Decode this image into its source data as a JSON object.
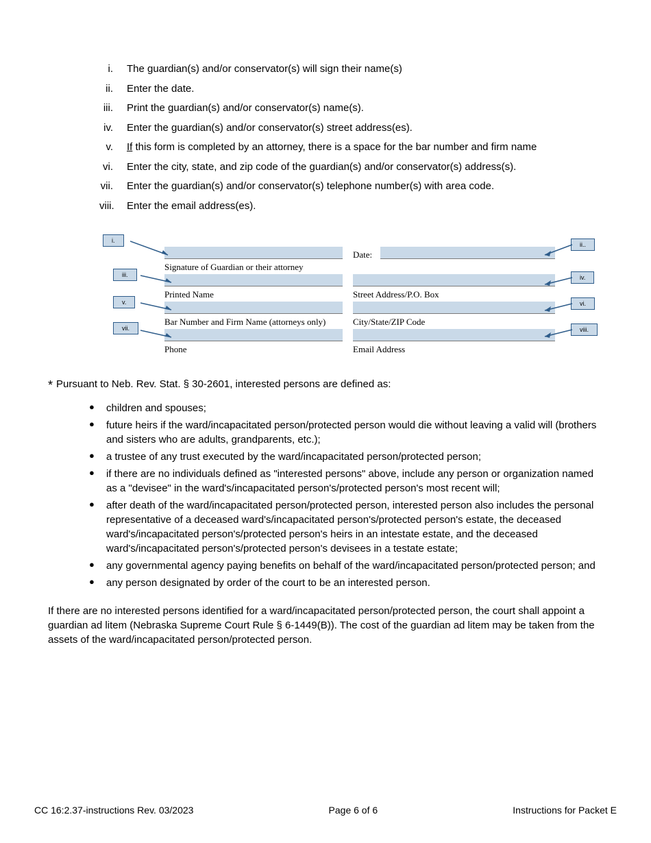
{
  "roman_list": [
    {
      "num": "i.",
      "text": "The guardian(s) and/or conservator(s) will sign their name(s)"
    },
    {
      "num": "ii.",
      "text": "Enter the date."
    },
    {
      "num": "iii.",
      "text": "Print the guardian(s) and/or conservator(s) name(s)."
    },
    {
      "num": "iv.",
      "text": "Enter the guardian(s) and/or conservator(s) street address(es)."
    },
    {
      "num": "v.",
      "text_prefix": "",
      "text_underline": "If",
      "text_suffix": " this form is completed by an attorney, there is a space for the bar number and firm name"
    },
    {
      "num": "vi.",
      "text": "Enter the city, state, and zip code of the guardian(s) and/or conservator(s) address(s)."
    },
    {
      "num": "vii.",
      "text": "Enter the guardian(s) and/or conservator(s) telephone number(s) with area code."
    },
    {
      "num": "viii.",
      "text": "Enter the email address(es)."
    }
  ],
  "form": {
    "date_label": "Date:",
    "sig_label": "Signature of Guardian or their attorney",
    "printed_label": "Printed Name",
    "street_label": "Street Address/P.O. Box",
    "bar_label": "Bar Number and Firm Name (attorneys only)",
    "city_label": "City/State/ZIP Code",
    "phone_label": "Phone",
    "email_label": "Email Address",
    "callouts": {
      "i": "i.",
      "ii": "ii..",
      "iii": "iii.",
      "iv": "iv.",
      "v": "v.",
      "vi": "vi.",
      "vii": "vii.",
      "viii": "viii."
    }
  },
  "star": {
    "intro": "Pursuant to Neb. Rev. Stat. § 30-2601, interested persons are defined as:",
    "bullets": [
      "children and spouses;",
      "future heirs if the ward/incapacitated person/protected person would die without leaving a valid will (brothers and sisters who are adults, grandparents, etc.);",
      "a trustee of any trust executed by the ward/incapacitated person/protected person;",
      "if there are no individuals defined as \"interested persons\" above, include any person or organization named as a \"devisee\" in the ward's/incapacitated person's/protected person's most recent will;",
      "after death of the ward/incapacitated person/protected person, interested person also includes the personal representative of a deceased ward's/incapacitated person's/protected person's estate, the deceased ward's/incapacitated person's/protected person's heirs in an intestate estate, and the deceased ward's/incapacitated person's/protected person's devisees in a testate estate;",
      "any governmental agency paying benefits on behalf of the ward/incapacitated person/protected person; and",
      "any person designated by order of the court to be an interested person."
    ],
    "closing": "If there are no interested persons identified for a ward/incapacitated person/protected person, the court shall appoint a guardian ad litem (Nebraska Supreme Court Rule § 6-1449(B)). The cost of the guardian ad litem may be taken from the assets of the ward/incapacitated person/protected person."
  },
  "footer": {
    "left": "CC 16:2.37-instructions Rev. 03/2023",
    "center": "Page 6 of 6",
    "right": "Instructions for Packet E"
  }
}
